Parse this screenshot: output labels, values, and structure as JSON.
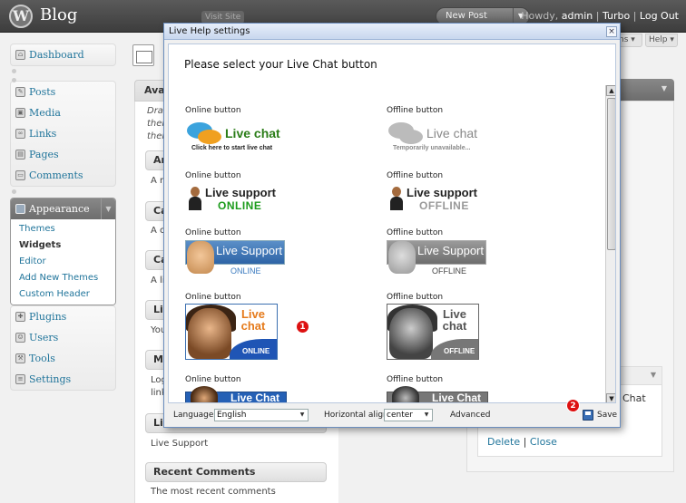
{
  "header": {
    "logo_letter": "W",
    "site_title": "Blog",
    "visit_site": "Visit Site",
    "new_post": "New Post",
    "howdy_prefix": "Howdy,",
    "user": "admin",
    "turbo": "Turbo",
    "logout": "Log Out",
    "screen_options": "ns",
    "help": "Help"
  },
  "menu": {
    "dashboard": "Dashboard",
    "posts": "Posts",
    "media": "Media",
    "links": "Links",
    "pages": "Pages",
    "comments": "Comments",
    "appearance": "Appearance",
    "appearance_sub": [
      "Themes",
      "Widgets",
      "Editor",
      "Add New Themes",
      "Custom Header"
    ],
    "plugins": "Plugins",
    "users": "Users",
    "tools": "Tools",
    "settings": "Settings"
  },
  "background": {
    "panel_head": "Avai",
    "intro_lines": [
      "Drag",
      "ther",
      "thei"
    ],
    "widgets": [
      {
        "title": "Ar",
        "desc": "A m"
      },
      {
        "title": "Ca",
        "desc": "A c"
      },
      {
        "title": "Ca",
        "desc": "A li"
      },
      {
        "title": "Lin",
        "desc": "You"
      },
      {
        "title": "Me",
        "desc": "Log"
      },
      {
        "title": "Liv",
        "desc": "Live Support"
      },
      {
        "title": "Recent Comments",
        "desc": "The most recent comments"
      }
    ],
    "meta_desc2": "link",
    "right_chat": "Chat",
    "delete": "Delete",
    "close": "Close",
    "separator": "|"
  },
  "dialog": {
    "title": "Live Help settings",
    "close_symbol": "×",
    "heading": "Please select your Live Chat button",
    "online_label": "Online button",
    "offline_label": "Offline button",
    "buttons": {
      "b1_title": "Live chat",
      "b1_on_sub": "Click here to start live chat",
      "b1_off_sub": "Temporarily unavailable...",
      "b2_title": "Live support",
      "b2_on": "ONLINE",
      "b2_off": "OFFLINE",
      "b3_title": "Live Support",
      "b3_on": "ONLINE",
      "b3_off": "OFFLINE",
      "b4_title": "Live chat",
      "b4_on": "ONLINE",
      "b4_off": "OFFLINE",
      "b5_title": "Live Chat"
    },
    "footer": {
      "language_label": "Language:",
      "language_value": "English",
      "align_label": "Horizontal align:",
      "align_value": "center",
      "advanced": "Advanced",
      "save": "Save"
    }
  },
  "badges": {
    "one": "1",
    "two": "2"
  },
  "colors": {
    "badge": "#dd1111",
    "link": "#21759b",
    "dialog_border": "#6a8dbe"
  }
}
